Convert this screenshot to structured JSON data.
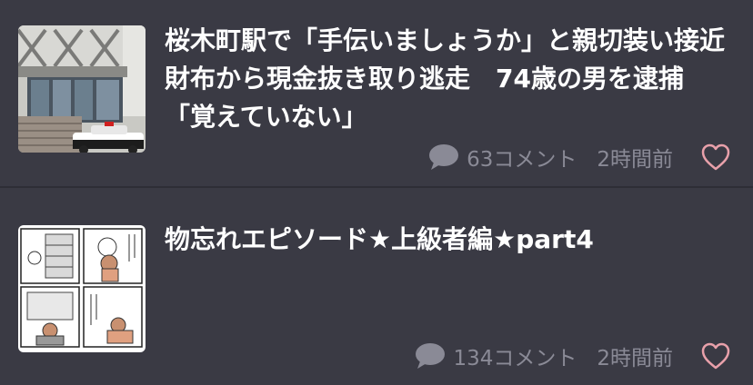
{
  "articles": [
    {
      "title": "桜木町駅で「手伝いましょうか」と親切装い接近　財布から現金抜き取り逃走　74歳の男を逮捕「覚えていない」",
      "comment_count": "63",
      "comment_suffix": "コメント",
      "time_ago": "2時間前",
      "thumbnail": "station-police-car-photo"
    },
    {
      "title": "物忘れエピソード★上級者編★part4",
      "comment_count": "134",
      "comment_suffix": "コメント",
      "time_ago": "2時間前",
      "thumbnail": "manga-comic-panels"
    }
  ],
  "colors": {
    "background": "#3a3a44",
    "title": "#ffffff",
    "meta": "#8a8a96",
    "heart": "#e8a0aa"
  },
  "icons": {
    "comment": "speech-bubble-icon",
    "like": "heart-outline-icon"
  }
}
